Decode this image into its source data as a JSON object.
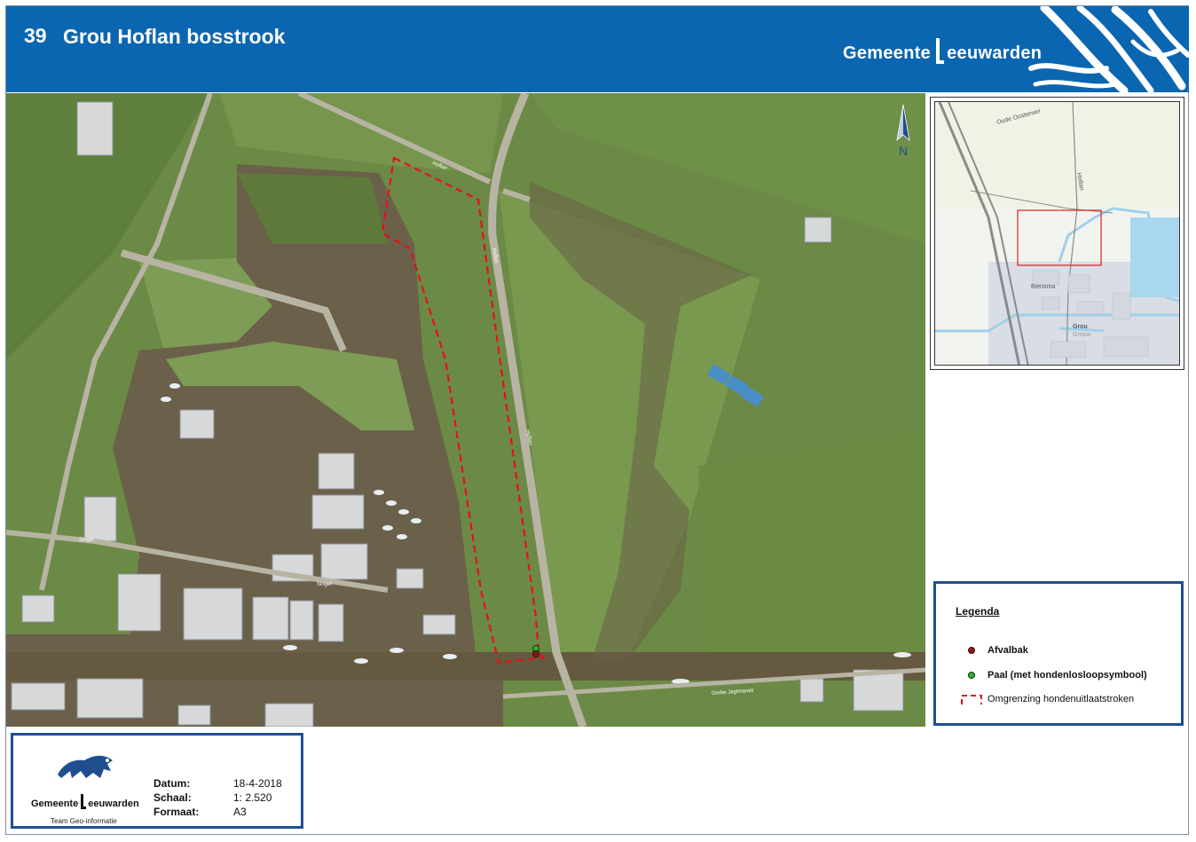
{
  "header": {
    "map_number": "39",
    "map_title": "Grou Hoflan bosstrook",
    "brand_prefix": "Gemeente",
    "brand_suffix": "eeuwarden",
    "background_color": "#0b66b2"
  },
  "north_arrow": {
    "label": "N"
  },
  "aerial": {
    "road_labels": [
      "Hoflan",
      "Hoflan",
      "Hoflan",
      "Singel",
      "Singel",
      "Gerbe Jagtmanstr"
    ],
    "boundary_color": "#e8101c"
  },
  "inset_map": {
    "place_labels": [
      "Biensma",
      "Grou",
      "Grouw",
      "Hoflan",
      "Oude Oosterwei"
    ],
    "extent_box_color": "#e0201c"
  },
  "legend": {
    "title": "Legenda",
    "items": [
      {
        "symbol": "afvalbak-dot",
        "color": "#8b1a1a",
        "label": "Afvalbak"
      },
      {
        "symbol": "paal-dot",
        "color": "#2bb32b",
        "label": "Paal (met hondenlosloopsymbool)"
      },
      {
        "symbol": "dashed-boundary",
        "color": "#e8101c",
        "label": "Omgrenzing hondenuitlaatstroken"
      }
    ]
  },
  "info": {
    "org_prefix": "Gemeente",
    "org_suffix": "eeuwarden",
    "department": "Team Geo-informatie",
    "datum_label": "Datum:",
    "datum_value": "18-4-2018",
    "schaal_label": "Schaal:",
    "schaal_value": "1: 2.520",
    "formaat_label": "Formaat:",
    "formaat_value": "A3"
  }
}
